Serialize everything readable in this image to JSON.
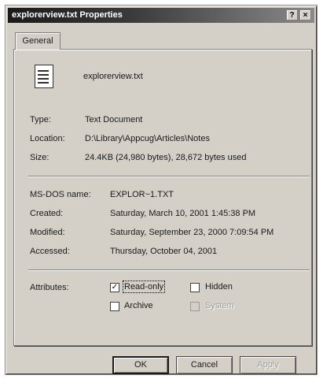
{
  "window": {
    "title": "explorerview.txt Properties",
    "help_glyph": "?",
    "close_glyph": "×"
  },
  "tabs": [
    {
      "label": "General"
    }
  ],
  "file": {
    "name": "explorerview.txt",
    "icon": "text-document-icon"
  },
  "info": {
    "type_label": "Type:",
    "type_value": "Text Document",
    "location_label": "Location:",
    "location_value": "D:\\Library\\Appcug\\Articles\\Notes",
    "size_label": "Size:",
    "size_value": "24.4KB (24,980 bytes), 28,672 bytes used"
  },
  "dates": {
    "msdos_label": "MS-DOS name:",
    "msdos_value": "EXPLOR~1.TXT",
    "created_label": "Created:",
    "created_value": "Saturday, March 10, 2001 1:45:38 PM",
    "modified_label": "Modified:",
    "modified_value": "Saturday, September 23, 2000 7:09:54 PM",
    "accessed_label": "Accessed:",
    "accessed_value": "Thursday, October 04, 2001"
  },
  "attributes": {
    "label": "Attributes:",
    "readonly": {
      "label": "Read-only",
      "checked": true
    },
    "hidden": {
      "label": "Hidden",
      "checked": false
    },
    "archive": {
      "label": "Archive",
      "checked": false
    },
    "system": {
      "label": "System",
      "checked": false,
      "disabled": true
    },
    "check_glyph": "✓"
  },
  "buttons": {
    "ok": "OK",
    "cancel": "Cancel",
    "apply": "Apply"
  }
}
